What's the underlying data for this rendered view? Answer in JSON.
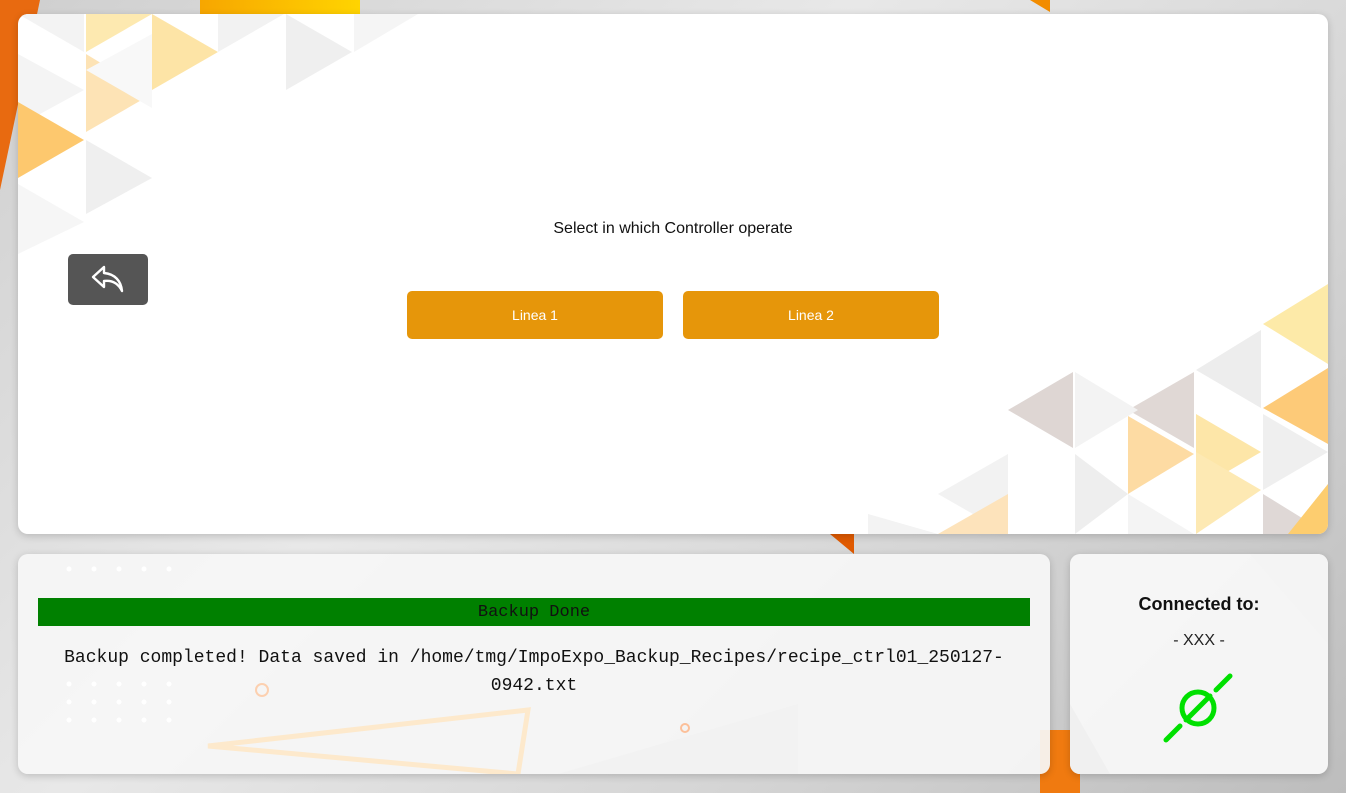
{
  "main": {
    "prompt": "Select in which Controller operate",
    "back_icon": "reply-arrow-icon",
    "buttons": [
      {
        "label": "Linea 1"
      },
      {
        "label": "Linea 2"
      }
    ],
    "button_color": "#e6960a"
  },
  "log": {
    "status": "Backup Done",
    "status_color": "#008000",
    "message": "Backup completed! Data saved in /home/tmg/ImpoExpo_Backup_Recipes/recipe_ctrl01_250127-0942.txt"
  },
  "connection": {
    "title": "Connected to:",
    "value": "- XXX -",
    "icon": "plug-connected-icon",
    "icon_color": "#00e000"
  }
}
